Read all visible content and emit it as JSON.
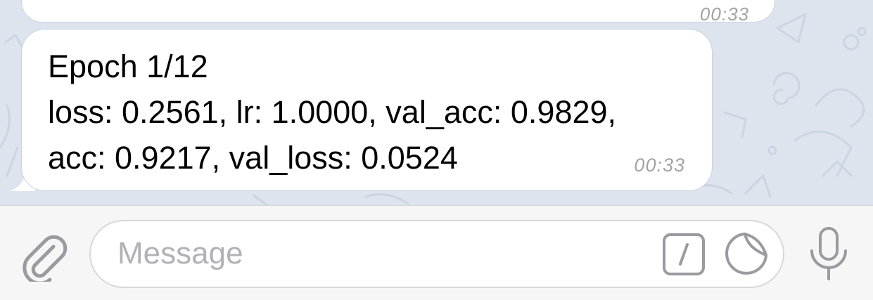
{
  "chat": {
    "previous_message": {
      "time": "00:33"
    },
    "message": {
      "lines": [
        "Epoch 1/12",
        "loss: 0.2561, lr: 1.0000, val_acc: 0.9829,",
        "acc: 0.9217, val_loss: 0.0524"
      ],
      "time": "00:33"
    }
  },
  "input_bar": {
    "placeholder": "Message",
    "value": "",
    "icons": {
      "attach": "paperclip-icon",
      "commands": "slash-command-icon",
      "sticker": "sticker-icon",
      "voice": "microphone-icon"
    }
  },
  "colors": {
    "chat_background": "#dde4ee",
    "bubble": "#ffffff",
    "timestamp": "#a3a3a3",
    "icon": "#9a9aa0",
    "placeholder": "#b1b1b6"
  }
}
